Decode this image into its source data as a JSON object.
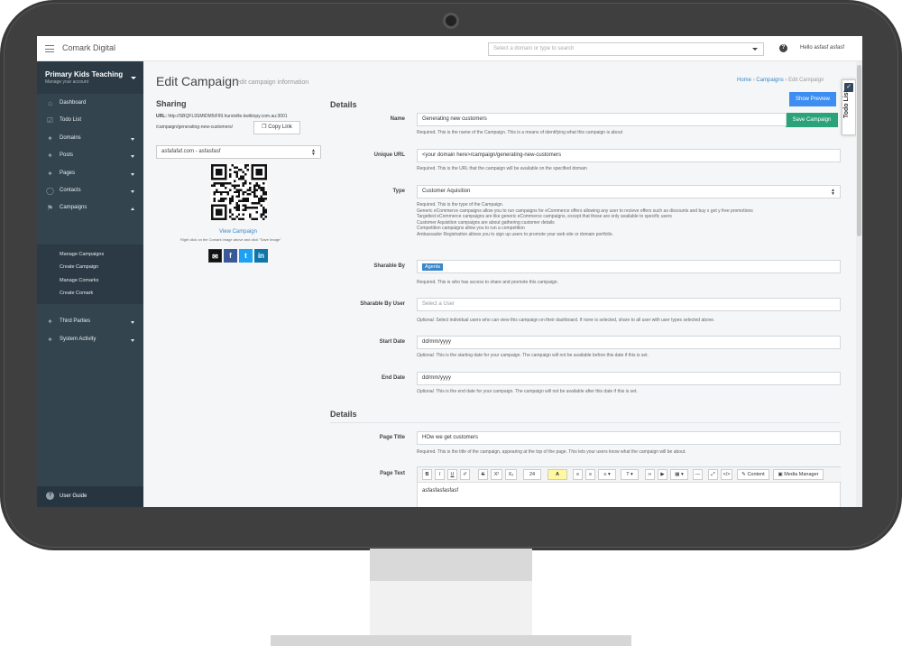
{
  "topbar": {
    "brand": "Comark Digital",
    "domain_placeholder": "Select a domain or type to search",
    "hello": "Hello asfasf asfasf"
  },
  "sidebar": {
    "org_name": "Primary Kids Teaching",
    "org_sub": "Manage your account",
    "items": [
      {
        "label": "Dashboard",
        "icon": "home-icon"
      },
      {
        "label": "Todo List",
        "icon": "checkbox-icon"
      },
      {
        "label": "Domains",
        "icon": "pin-icon"
      },
      {
        "label": "Posts",
        "icon": "pin-icon"
      },
      {
        "label": "Pages",
        "icon": "pin-icon"
      },
      {
        "label": "Contacts",
        "icon": "globe-icon"
      },
      {
        "label": "Campaigns",
        "icon": "tag-icon"
      },
      {
        "label": "Third Parties",
        "icon": "pin-icon"
      },
      {
        "label": "System Activity",
        "icon": "pin-icon"
      }
    ],
    "campaign_sub": [
      "Manage Campaigns",
      "Create Campaign",
      "Manage Comarks",
      "Create Comark"
    ],
    "user_guide": "User Guide"
  },
  "header": {
    "title": "Edit Campaign",
    "subtitle": "edit campaign information",
    "breadcrumb": [
      "Home",
      "Campaigns",
      "Edit Campaign"
    ],
    "preview_label": "Show Preview",
    "save_label": "Save Campaign",
    "todo_label": "Todo List"
  },
  "sharing": {
    "title": "Sharing",
    "url_label": "URL:",
    "url_line1": "http://SBQFL9SMtDM5iF99.hurstville.kwiklopy.com.au:3001",
    "url_line2": "/campaign/generating-new-customers/",
    "copy_label": "Copy Link",
    "domain_value": "asfafafaf.com - asfasfasf",
    "view_campaign": "View Campaign",
    "qr_hint": "Right click on the Comark image above and click \"Save Image\""
  },
  "details": {
    "title": "Details",
    "name_label": "Name",
    "name_value": "Generating new customers",
    "name_help": "Required. This is the name of the Campaign. This is a means of identifying what this campaign is about",
    "url_label": "Unique URL",
    "url_value": "<your domain here>/campaign/generating-new-customers",
    "url_help": "Required. This is the URL that the campaign will be available on the specified domain",
    "type_label": "Type",
    "type_value": "Customer Aquisition",
    "type_help": [
      "Required. This is the type of the Campaign.",
      "Generic eCommerce campaigns allow you to run campaigns for eCommerce offers allowing any user to recieve offers such as discounts and buy x get y free promotions",
      "Targetted eCommerce campaigns are like generic eCommerce campaigns, except that these are only available to specific users",
      "Customer Aquisition campaigns are about gathering customer details",
      "Competition campaigns allow you to run a competition",
      "Ambassador Registration allows you to sign up users to promote your web site or domain portfolio."
    ],
    "sharable_label": "Sharable By",
    "sharable_tag": "Agents",
    "sharable_help": "Required. This is who has access to share and promote this campaign.",
    "sharable_user_label": "Sharable By User",
    "sharable_user_placeholder": "Select a User",
    "sharable_user_help_em": "Optional.",
    "sharable_user_help": " Select individual users who can view this campaign on their dashboard. If none is selected, share to all user with user types selected above.",
    "start_label": "Start Date",
    "start_placeholder": "dd/mm/yyyy",
    "start_help_em": "Optional.",
    "start_help": " This is the starting date for your campaign. The campaign will not be available before this date if this is set.",
    "end_label": "End Date",
    "end_placeholder": "dd/mm/yyyy",
    "end_help_em": "Optional.",
    "end_help": " This is the end date for your campaign. The campaign will not be available after this date if this is set."
  },
  "details2": {
    "title": "Details",
    "page_title_label": "Page Title",
    "page_title_value": "HOw we get customers",
    "page_title_help": "Required. This is the title of the campaign, appearing at the top of the page. This lets your users know what the campaign will be about.",
    "page_text_label": "Page Text",
    "page_text_value": "asfasfasfasfasf",
    "toolbar": {
      "bold": "B",
      "italic": "I",
      "underline": "U",
      "eraser": "✐",
      "strike": "S",
      "sup": "X²",
      "sub": "X₂",
      "font_size": "24",
      "color": "A",
      "content": "Content",
      "media_manager": "Media Manager"
    }
  }
}
